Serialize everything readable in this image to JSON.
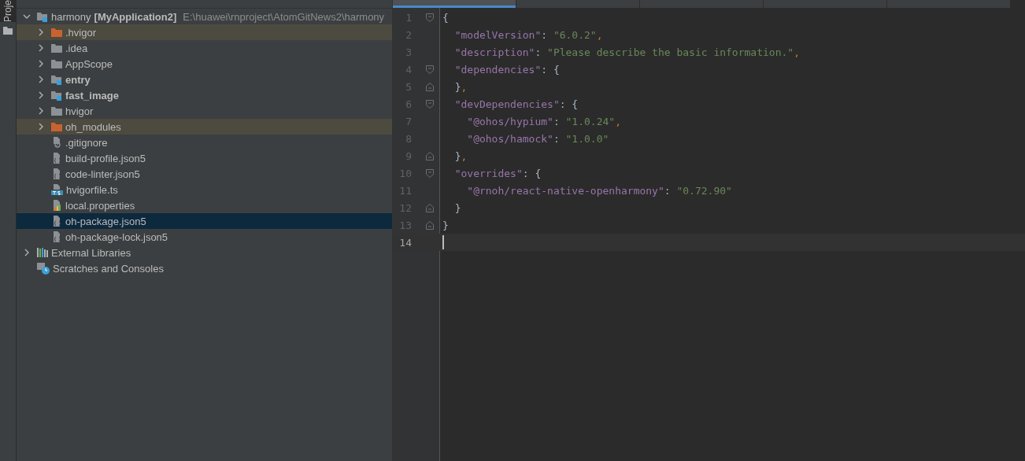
{
  "side_strip": {
    "tab_label": "Proje",
    "selected": true
  },
  "editor_tabs": [
    {
      "selected": true
    },
    {
      "selected": false
    },
    {
      "selected": false
    },
    {
      "selected": false
    },
    {
      "selected": false
    }
  ],
  "project_tree": {
    "root": {
      "label": "harmony",
      "module": "[MyApplication2]",
      "path": "E:\\huawei\\rnproject\\AtomGitNews2\\harmony",
      "expanded": true,
      "kind": "module-folder",
      "children": [
        {
          "label": ".hvigor",
          "kind": "excluded-folder",
          "expanded": false,
          "bold": false,
          "selected": false
        },
        {
          "label": ".idea",
          "kind": "folder",
          "expanded": false,
          "bold": false,
          "selected": false
        },
        {
          "label": "AppScope",
          "kind": "folder",
          "expanded": false,
          "bold": false,
          "selected": false
        },
        {
          "label": "entry",
          "kind": "module-folder",
          "expanded": false,
          "bold": true,
          "selected": false
        },
        {
          "label": "fast_image",
          "kind": "module-folder",
          "expanded": false,
          "bold": true,
          "selected": false
        },
        {
          "label": "hvigor",
          "kind": "folder",
          "expanded": false,
          "bold": false,
          "selected": false
        },
        {
          "label": "oh_modules",
          "kind": "excluded-folder",
          "expanded": false,
          "bold": false,
          "selected": false
        },
        {
          "label": ".gitignore",
          "kind": "ignore-file",
          "bold": false,
          "selected": false
        },
        {
          "label": "build-profile.json5",
          "kind": "json-file",
          "bold": false,
          "selected": false
        },
        {
          "label": "code-linter.json5",
          "kind": "json-file",
          "bold": false,
          "selected": false
        },
        {
          "label": "hvigorfile.ts",
          "kind": "ts-file",
          "bold": false,
          "selected": false
        },
        {
          "label": "local.properties",
          "kind": "properties-file",
          "bold": false,
          "selected": false
        },
        {
          "label": "oh-package.json5",
          "kind": "json-file",
          "bold": false,
          "selected": true
        },
        {
          "label": "oh-package-lock.json5",
          "kind": "json-file",
          "bold": false,
          "selected": false
        }
      ]
    },
    "others": [
      {
        "label": "External Libraries",
        "kind": "libraries",
        "expanded": false
      },
      {
        "label": "Scratches and Consoles",
        "kind": "scratches"
      }
    ]
  },
  "editor": {
    "lines": [
      {
        "number": "1",
        "kind": "fold-start",
        "current": false,
        "tokens": [
          {
            "text": "{",
            "kind": "punct"
          }
        ]
      },
      {
        "number": "2",
        "kind": "plain",
        "current": false,
        "tokens": [
          {
            "text": "  \"modelVersion\"",
            "kind": "key"
          },
          {
            "text": ": ",
            "kind": "punct"
          },
          {
            "text": "\"6.0.2\"",
            "kind": "string"
          },
          {
            "text": ",",
            "kind": "comma"
          }
        ]
      },
      {
        "number": "3",
        "kind": "plain",
        "current": false,
        "tokens": [
          {
            "text": "  \"description\"",
            "kind": "key"
          },
          {
            "text": ": ",
            "kind": "punct"
          },
          {
            "text": "\"Please describe the basic information.\"",
            "kind": "string"
          },
          {
            "text": ",",
            "kind": "comma"
          }
        ]
      },
      {
        "number": "4",
        "kind": "fold-start",
        "current": false,
        "tokens": [
          {
            "text": "  \"dependencies\"",
            "kind": "key"
          },
          {
            "text": ": {",
            "kind": "punct"
          }
        ]
      },
      {
        "number": "5",
        "kind": "fold-end",
        "current": false,
        "tokens": [
          {
            "text": "  }",
            "kind": "punct"
          },
          {
            "text": ",",
            "kind": "comma"
          }
        ]
      },
      {
        "number": "6",
        "kind": "fold-start",
        "current": false,
        "tokens": [
          {
            "text": "  \"devDependencies\"",
            "kind": "key"
          },
          {
            "text": ": {",
            "kind": "punct"
          }
        ]
      },
      {
        "number": "7",
        "kind": "plain",
        "current": false,
        "tokens": [
          {
            "text": "    \"@ohos/hypium\"",
            "kind": "key"
          },
          {
            "text": ": ",
            "kind": "punct"
          },
          {
            "text": "\"1.0.24\"",
            "kind": "string"
          },
          {
            "text": ",",
            "kind": "comma"
          }
        ]
      },
      {
        "number": "8",
        "kind": "plain",
        "current": false,
        "tokens": [
          {
            "text": "    \"@ohos/hamock\"",
            "kind": "key"
          },
          {
            "text": ": ",
            "kind": "punct"
          },
          {
            "text": "\"1.0.0\"",
            "kind": "string"
          }
        ]
      },
      {
        "number": "9",
        "kind": "fold-end",
        "current": false,
        "tokens": [
          {
            "text": "  }",
            "kind": "punct"
          },
          {
            "text": ",",
            "kind": "comma"
          }
        ]
      },
      {
        "number": "10",
        "kind": "fold-start",
        "current": false,
        "tokens": [
          {
            "text": "  \"overrides\"",
            "kind": "key"
          },
          {
            "text": ": {",
            "kind": "punct"
          }
        ]
      },
      {
        "number": "11",
        "kind": "plain",
        "current": false,
        "tokens": [
          {
            "text": "    \"@rnoh/react-native-openharmony\"",
            "kind": "key"
          },
          {
            "text": ": ",
            "kind": "punct"
          },
          {
            "text": "\"0.72.90\"",
            "kind": "string"
          }
        ]
      },
      {
        "number": "12",
        "kind": "fold-end",
        "current": false,
        "tokens": [
          {
            "text": "  }",
            "kind": "punct"
          }
        ]
      },
      {
        "number": "13",
        "kind": "fold-end",
        "current": false,
        "tokens": [
          {
            "text": "}",
            "kind": "punct"
          }
        ]
      },
      {
        "number": "14",
        "kind": "plain",
        "current": true
      }
    ]
  }
}
